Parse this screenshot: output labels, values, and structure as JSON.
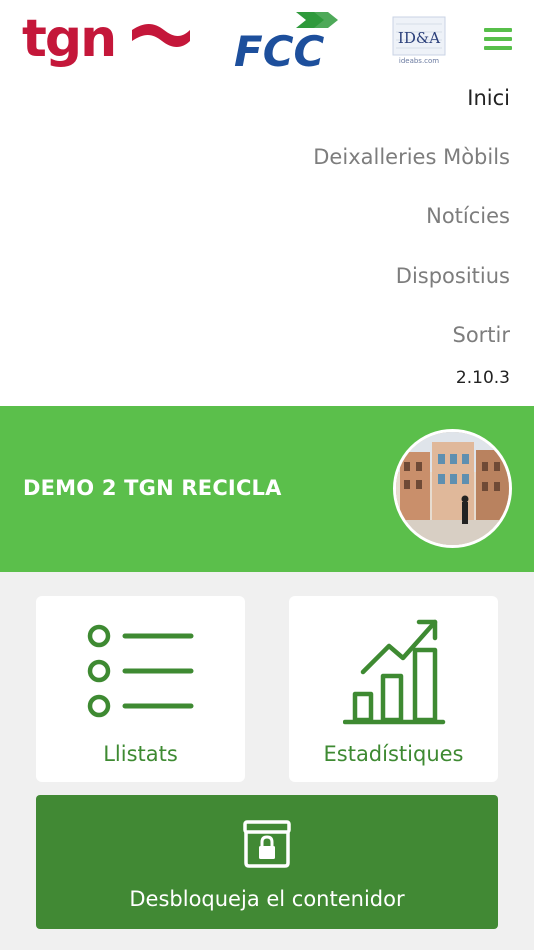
{
  "header": {
    "logo_tgn_text": "tgn",
    "logo_fcc_text": "FCC",
    "logo_idea_text": "ID&A",
    "logo_idea_sub": "ideabs.com",
    "menu_icon": "hamburger-menu-icon"
  },
  "menu": {
    "items": [
      {
        "label": "Inici",
        "active": true
      },
      {
        "label": "Deixalleries Mòbils",
        "active": false
      },
      {
        "label": "Notícies",
        "active": false
      },
      {
        "label": "Dispositius",
        "active": false
      },
      {
        "label": "Sortir",
        "active": false
      }
    ],
    "version": "2.10.3"
  },
  "banner": {
    "title": "DEMO 2 TGN RECICLA",
    "avatar": "profile-photo"
  },
  "cards": [
    {
      "label": "Llistats",
      "icon": "list-icon"
    },
    {
      "label": "Estadístiques",
      "icon": "bar-chart-icon"
    }
  ],
  "unlock": {
    "label": "Desbloqueja el contenidor",
    "icon": "locked-container-icon"
  },
  "colors": {
    "green_light": "#5bbf4b",
    "green_dark": "#418934",
    "tgn_red": "#c4173a",
    "fcc_blue": "#1d4f9c",
    "fcc_green": "#2f9a3c"
  }
}
